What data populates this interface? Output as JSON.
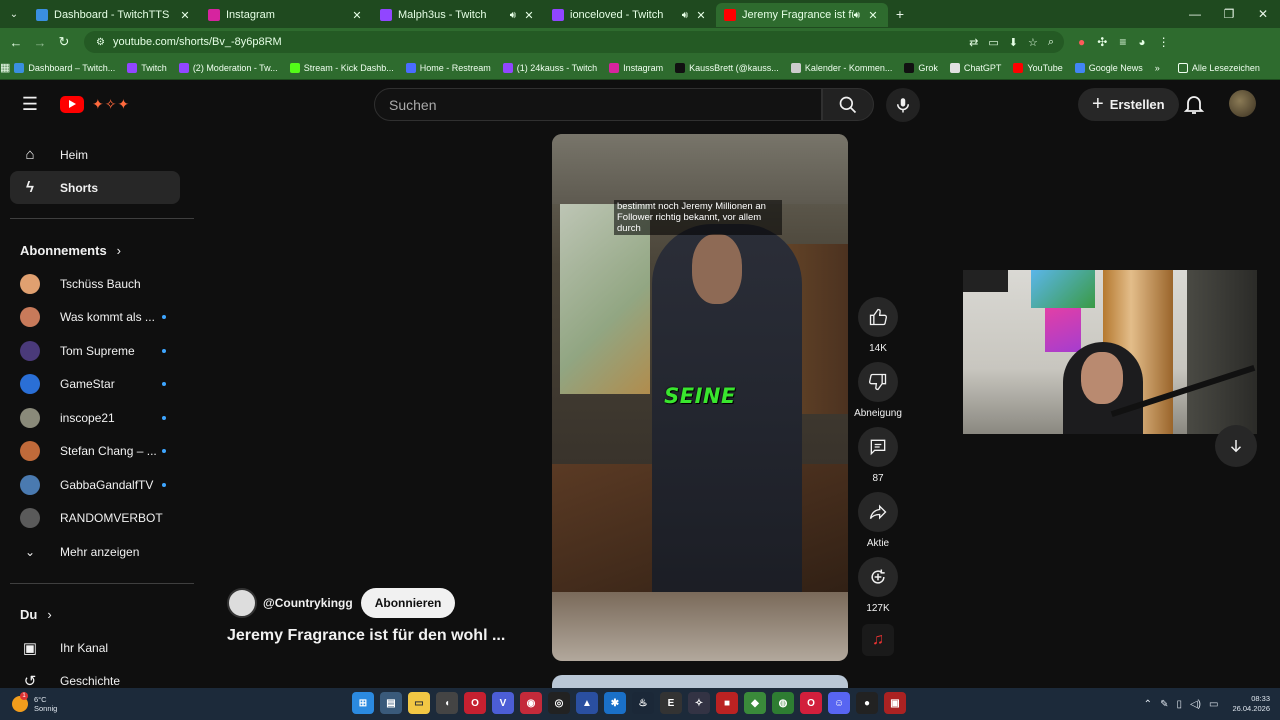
{
  "browser": {
    "tabs": [
      {
        "title": "Dashboard - TwitchTTS",
        "color": "#3a8fe0",
        "active": false,
        "audio": false
      },
      {
        "title": "Instagram",
        "color": "#d6249f",
        "active": false,
        "audio": false
      },
      {
        "title": "Malph3us - Twitch",
        "color": "#9146ff",
        "active": false,
        "audio": true
      },
      {
        "title": "ionceloved - Twitch",
        "color": "#9146ff",
        "active": false,
        "audio": true
      },
      {
        "title": "Jeremy Fragrance ist für de",
        "color": "#ff0000",
        "active": true,
        "audio": true
      }
    ],
    "url": "youtube.com/shorts/Bv_-8y6p8RM",
    "bookmarks": [
      {
        "label": "Dashboard – Twitch...",
        "color": "#3a8fe0"
      },
      {
        "label": "Twitch",
        "color": "#9146ff"
      },
      {
        "label": "(2) Moderation - Tw...",
        "color": "#9146ff"
      },
      {
        "label": "Stream - Kick Dashb...",
        "color": "#53fc18"
      },
      {
        "label": "Home - Restream",
        "color": "#4a6cff"
      },
      {
        "label": "(1) 24kauss - Twitch",
        "color": "#9146ff"
      },
      {
        "label": "Instagram",
        "color": "#d6249f"
      },
      {
        "label": "KaussBrett (@kauss...",
        "color": "#111111"
      },
      {
        "label": "Kalender - Kommen...",
        "color": "#cccccc"
      },
      {
        "label": "Grok",
        "color": "#111111"
      },
      {
        "label": "ChatGPT",
        "color": "#e0e0e0"
      },
      {
        "label": "YouTube",
        "color": "#ff0000"
      },
      {
        "label": "Google News",
        "color": "#4285f4"
      }
    ],
    "all_bookmarks": "Alle Lesezeichen"
  },
  "header": {
    "search_placeholder": "Suchen",
    "create_label": "Erstellen"
  },
  "sidebar": {
    "items": [
      {
        "label": "Heim",
        "icon": "home-icon"
      },
      {
        "label": "Shorts",
        "icon": "shorts-icon"
      }
    ],
    "subscriptions_title": "Abonnements",
    "subscriptions": [
      {
        "name": "Tschüss Bauch",
        "color": "#e0a070",
        "dot": false
      },
      {
        "name": "Was kommt als ...",
        "color": "#c87a5a",
        "dot": true
      },
      {
        "name": "Tom Supreme",
        "color": "#4a3a7a",
        "dot": true
      },
      {
        "name": "GameStar",
        "color": "#2a6fd6",
        "dot": true
      },
      {
        "name": "inscope21",
        "color": "#8a8a7a",
        "dot": true
      },
      {
        "name": "Stefan Chang – ...",
        "color": "#c06a3a",
        "dot": true
      },
      {
        "name": "GabbaGandalfTV",
        "color": "#4a7ab0",
        "dot": true
      },
      {
        "name": "RANDOMVERBOT",
        "color": "#5a5a5a",
        "dot": false
      }
    ],
    "show_more": "Mehr anzeigen",
    "you_title": "Du",
    "you_items": [
      {
        "label": "Ihr Kanal",
        "icon": "channel-icon"
      },
      {
        "label": "Geschichte",
        "icon": "history-icon"
      }
    ]
  },
  "short": {
    "caption": "bestimmt noch Jeremy Millionen an Follower richtig bekannt, vor allem durch",
    "overlay_word": "SEINE",
    "channel": "@Countrykingg",
    "subscribe_label": "Abonnieren",
    "title": "Jeremy Fragrance ist für den wohl ..."
  },
  "actions": {
    "likes": "14K",
    "dislike_label": "Abneigung",
    "comments": "87",
    "share_label": "Aktie",
    "remix": "127K"
  },
  "taskbar": {
    "temperature": "6°C",
    "weather": "Sonnig",
    "weather_badge": "1",
    "time": "08:33",
    "date": "26.04.2026"
  }
}
